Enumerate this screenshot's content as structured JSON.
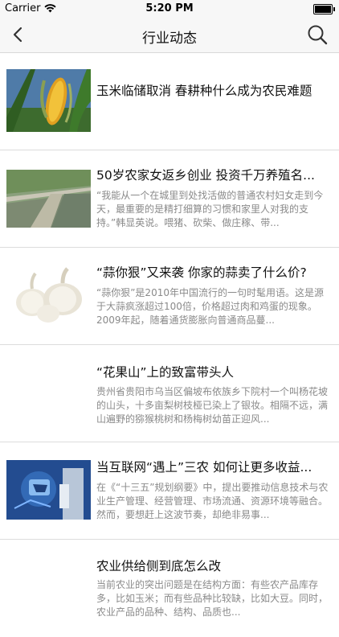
{
  "status_bar": {
    "carrier": "Carrier",
    "time": "5:20 PM"
  },
  "nav": {
    "title": "行业动态",
    "back_icon": "chevron-left-icon",
    "search_icon": "search-icon"
  },
  "articles": [
    {
      "title": "玉米临储取消 春耕种什么成为农民难题",
      "summary": ""
    },
    {
      "title": "50岁农家女返乡创业 投资千万养殖名...",
      "summary": "“我能从一个在城里到处找活做的普通农村妇女走到今天，最重要的是精打细算的习惯和家里人对我的支持。”韩显英说。喂猪、砍柴、做庄稼、带..."
    },
    {
      "title": "“蒜你狠”又来袭 你家的蒜卖了什么价?",
      "summary": "“蒜你狠”是2010年中国流行的一句时髦用语。这是源于大蒜疯涨超过100倍，价格超过肉和鸡蛋的现象。2009年起，随着通货膨胀向普通商品蔓..."
    },
    {
      "title": "“花果山”上的致富带头人",
      "summary": "贵州省贵阳市乌当区偏坡布依族乡下院村一个叫杨花坡的山头，十多亩梨树枝桠已染上了银妆。相隔不远，满山遍野的猕猴桃树和杨梅树幼苗正迎风..."
    },
    {
      "title": "当互联网“遇上”三农 如何让更多收益...",
      "summary": "在《“十三五”规划纲要》中，提出要推动信息技术与农业生产管理、经营管理、市场流通、资源环境等融合。然而，要想赶上这波节奏，却绝非易事..."
    },
    {
      "title": "农业供给侧到底怎么改",
      "summary": "当前农业的突出问题是在结构方面：有些农产品库存多，比如玉米；而有些品种比较缺，比如大豆。同时，农业产品的品种、结构、品质也..."
    }
  ]
}
